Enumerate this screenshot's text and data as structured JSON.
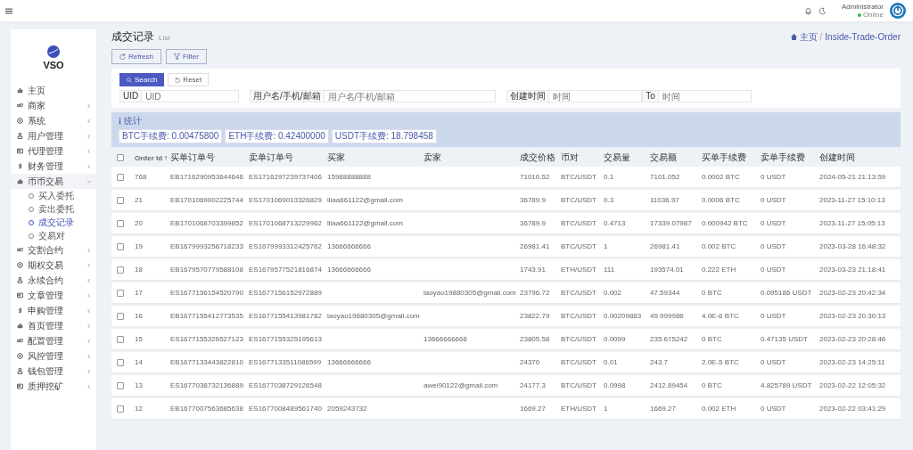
{
  "topbar": {
    "user": {
      "name": "Administrator",
      "status": "Online",
      "online": true
    }
  },
  "brand": "VSO",
  "sidebar": {
    "items": [
      {
        "label": "主页",
        "expandable": false,
        "expanded": false
      },
      {
        "label": "商家",
        "expandable": true,
        "expanded": false
      },
      {
        "label": "系统",
        "expandable": true,
        "expanded": false
      },
      {
        "label": "用户管理",
        "expandable": true,
        "expanded": false
      },
      {
        "label": "代理管理",
        "expandable": true,
        "expanded": false
      },
      {
        "label": "财务管理",
        "expandable": true,
        "expanded": false
      },
      {
        "label": "币币交易",
        "expandable": true,
        "expanded": true,
        "children": [
          {
            "label": "买入委托",
            "selected": false
          },
          {
            "label": "卖出委托",
            "selected": false
          },
          {
            "label": "成交记录",
            "selected": true
          },
          {
            "label": "交易对",
            "selected": false
          }
        ]
      },
      {
        "label": "交割合约",
        "expandable": true,
        "expanded": false
      },
      {
        "label": "期权交易",
        "expandable": true,
        "expanded": false
      },
      {
        "label": "永续合约",
        "expandable": true,
        "expanded": false
      },
      {
        "label": "文章管理",
        "expandable": true,
        "expanded": false
      },
      {
        "label": "申购管理",
        "expandable": true,
        "expanded": false
      },
      {
        "label": "首页管理",
        "expandable": true,
        "expanded": false
      },
      {
        "label": "配置管理",
        "expandable": true,
        "expanded": false
      },
      {
        "label": "风控管理",
        "expandable": true,
        "expanded": false
      },
      {
        "label": "钱包管理",
        "expandable": true,
        "expanded": false
      },
      {
        "label": "质押挖矿",
        "expandable": true,
        "expanded": false
      }
    ]
  },
  "page": {
    "title": "成交记录",
    "subtitle": "List",
    "breadcrumb": [
      "主页",
      "Inside-Trade-Order"
    ],
    "breadcrumb_separator": "/",
    "toolbar": [
      "Refresh",
      "Filter"
    ]
  },
  "filter": {
    "buttons": [
      "Search",
      "Reset"
    ],
    "fields": [
      {
        "label": "UID",
        "placeholder": "UID"
      },
      {
        "label": "用户名/手机/邮箱",
        "placeholder": "用户名/手机/邮箱"
      }
    ],
    "date_range": {
      "label": "创建时间",
      "from_placeholder": "时间",
      "separator": "To",
      "to_placeholder": "时间"
    }
  },
  "stats": {
    "title": "统计",
    "badges": [
      "BTC手续费: 0.00475800",
      "ETH手续费: 0.42400000",
      "USDT手续费: 18.798458"
    ]
  },
  "table": {
    "all_checked": false,
    "columns": [
      {
        "label": "Order Id",
        "sorted": true
      },
      {
        "label": "买单订单号",
        "sorted": false
      },
      {
        "label": "卖单订单号",
        "sorted": false
      },
      {
        "label": "买家",
        "sorted": false
      },
      {
        "label": "卖家",
        "sorted": false
      },
      {
        "label": "成交价格",
        "sorted": false
      },
      {
        "label": "币对",
        "sorted": false
      },
      {
        "label": "交易量",
        "sorted": false
      },
      {
        "label": "交易额",
        "sorted": false
      },
      {
        "label": "买单手续费",
        "sorted": false
      },
      {
        "label": "卖单手续费",
        "sorted": false
      },
      {
        "label": "创建时间",
        "sorted": false
      }
    ],
    "rows": [
      {
        "checked": false,
        "cells": [
          "768",
          "EB1716290953644646",
          "ES1716297239737406",
          "15988888888",
          null,
          "71010.52",
          "BTC/USDT",
          "0.1",
          "7101.052",
          "0.0002 BTC",
          "0 USDT",
          "2024-05-21 21:13:59"
        ]
      },
      {
        "checked": false,
        "cells": [
          "21",
          "EB1701069002225744",
          "ES1701069013326829",
          "lilaa661122@gmail.com",
          null,
          "36789.9",
          "BTC/USDT",
          "0.3",
          "11036.97",
          "0.0006 BTC",
          "0 USDT",
          "2023-11-27 15:10:13"
        ]
      },
      {
        "checked": false,
        "cells": [
          "20",
          "EB1701068703399852",
          "ES1701068713229962",
          "lilaa661122@gmail.com",
          null,
          "36789.9",
          "BTC/USDT",
          "0.4713",
          "17339.07987",
          "0.000942 BTC",
          "0 USDT",
          "2023-11-27 15:05:13"
        ]
      },
      {
        "checked": false,
        "cells": [
          "19",
          "EB1679993256718233",
          "ES1679993312425762",
          "13666666666",
          null,
          "26981.41",
          "BTC/USDT",
          "1",
          "26981.41",
          "0.002 BTC",
          "0 USDT",
          "2023-03-28 16:48:32"
        ]
      },
      {
        "checked": false,
        "cells": [
          "18",
          "EB1679570779588108",
          "ES1679577521816874",
          "13666666666",
          null,
          "1743.91",
          "ETH/USDT",
          "111",
          "193574.01",
          "0.222 ETH",
          "0 USDT",
          "2023-03-23 21:18:41"
        ]
      },
      {
        "checked": false,
        "cells": [
          "17",
          "ES1677156154520790",
          "ES1677156152972889",
          null,
          "laoyao19880305@gmail.com",
          "23796.72",
          "BTC/USDT",
          "0.002",
          "47.59344",
          "0 BTC",
          "0.095186 USDT",
          "2023-02-23 20:42:34"
        ]
      },
      {
        "checked": false,
        "cells": [
          "16",
          "EB1677155412773535",
          "ES1677155413981782",
          "laoyao19880305@gmail.com",
          null,
          "23822.79",
          "BTC/USDT",
          "0.00209883",
          "49.999986",
          "4.0E-6 BTC",
          "0 USDT",
          "2023-02-23 20:30:13"
        ]
      },
      {
        "checked": false,
        "cells": [
          "15",
          "ES1677155326527123",
          "ES1677155325195613",
          null,
          "13666666666",
          "23805.58",
          "BTC/USDT",
          "0.0099",
          "235.675242",
          "0 BTC",
          "0.47135 USDT",
          "2023-02-23 20:28:46"
        ]
      },
      {
        "checked": false,
        "cells": [
          "14",
          "EB1677133443822810",
          "ES1677133511086599",
          "13666666666",
          null,
          "24370",
          "BTC/USDT",
          "0.01",
          "243.7",
          "2.0E-5 BTC",
          "0 USDT",
          "2023-02-23 14:25:11"
        ]
      },
      {
        "checked": false,
        "cells": [
          "13",
          "ES1677038732136889",
          "ES1677038729126548",
          null,
          "awei90122@gmail.com",
          "24177.3",
          "BTC/USDT",
          "0.0998",
          "2412.89454",
          "0 BTC",
          "4.825789 USDT",
          "2023-02-22 12:05:32"
        ]
      },
      {
        "checked": false,
        "cells": [
          "12",
          "EB1677007563685638",
          "ES1677008489561740",
          "2059243732",
          null,
          "1669.27",
          "ETH/USDT",
          "1",
          "1669.27",
          "0.002 ETH",
          "0 USDT",
          "2023-02-22 03:41:29"
        ]
      }
    ]
  }
}
